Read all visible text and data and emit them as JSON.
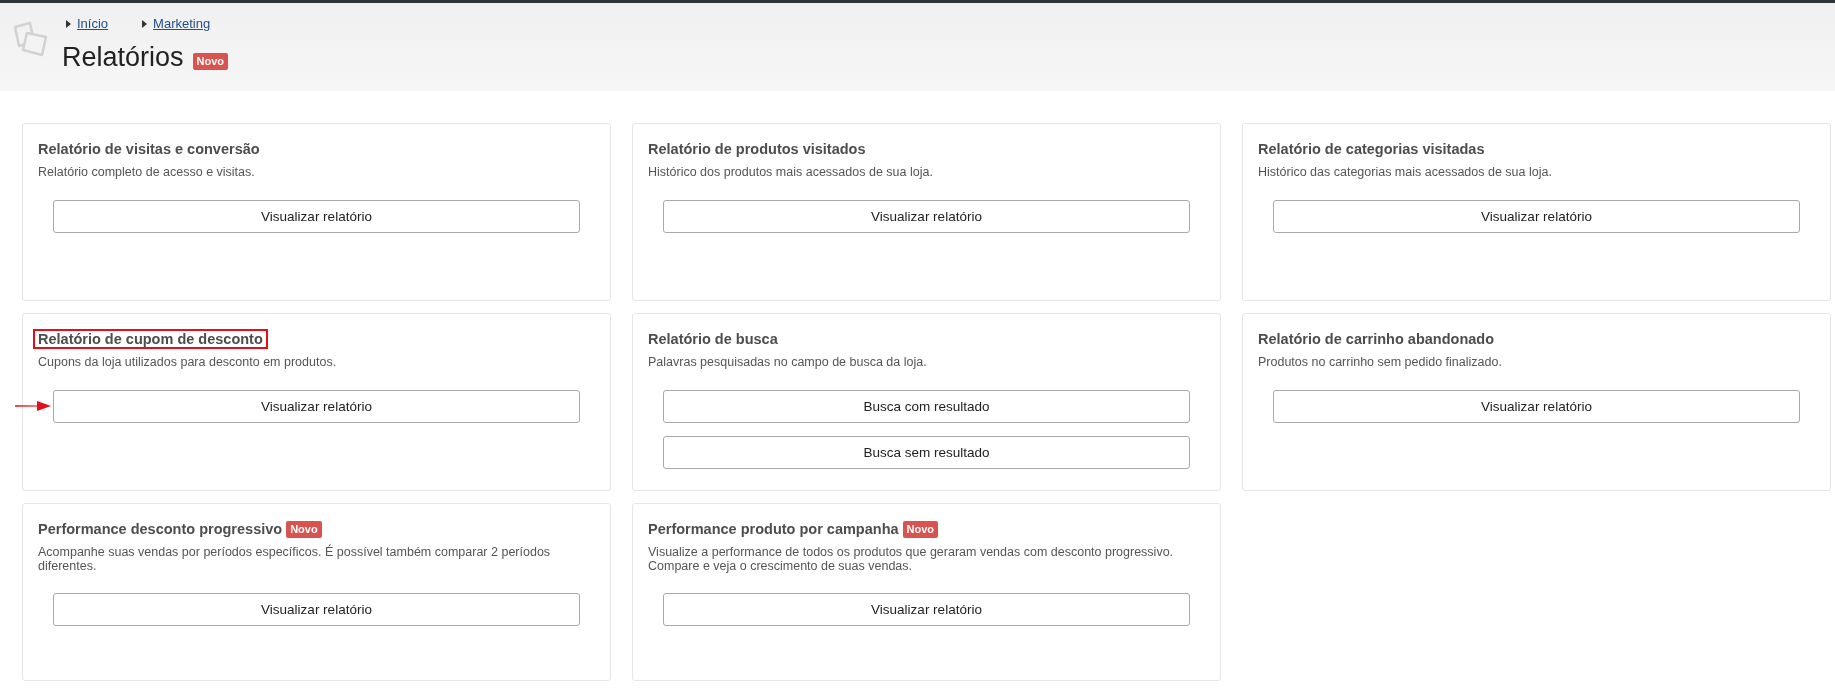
{
  "header": {
    "breadcrumb": [
      {
        "label": "Início"
      },
      {
        "label": "Marketing"
      }
    ],
    "title": "Relatórios",
    "badge": "Novo"
  },
  "cards": [
    {
      "title": "Relatório de visitas e conversão",
      "highlighted": false,
      "description": "Relatório completo de acesso e visitas.",
      "buttons": [
        {
          "label": "Visualizar relatório",
          "arrow": false
        }
      ]
    },
    {
      "title": "Relatório de produtos visitados",
      "highlighted": false,
      "description": "Histórico dos produtos mais acessados de sua loja.",
      "buttons": [
        {
          "label": "Visualizar relatório",
          "arrow": false
        }
      ]
    },
    {
      "title": "Relatório de categorias visitadas",
      "highlighted": false,
      "description": "Histórico das categorias mais acessados de sua loja.",
      "buttons": [
        {
          "label": "Visualizar relatório",
          "arrow": false
        }
      ]
    },
    {
      "title": "Relatório de cupom de desconto",
      "highlighted": true,
      "description": "Cupons da loja utilizados para desconto em produtos.",
      "buttons": [
        {
          "label": "Visualizar relatório",
          "arrow": true
        }
      ]
    },
    {
      "title": "Relatório de busca",
      "highlighted": false,
      "description": "Palavras pesquisadas no campo de busca da loja.",
      "buttons": [
        {
          "label": "Busca com resultado",
          "arrow": false
        },
        {
          "label": "Busca sem resultado",
          "arrow": false
        }
      ]
    },
    {
      "title": "Relatório de carrinho abandonado",
      "highlighted": false,
      "description": "Produtos no carrinho sem pedido finalizado.",
      "buttons": [
        {
          "label": "Visualizar relatório",
          "arrow": false
        }
      ]
    },
    {
      "title": "Performance desconto progressivo",
      "badge": "Novo",
      "highlighted": false,
      "description": "Acompanhe suas vendas por períodos específicos. É possível também comparar 2 períodos diferentes.",
      "buttons": [
        {
          "label": "Visualizar relatório",
          "arrow": false
        }
      ]
    },
    {
      "title": "Performance produto por campanha",
      "badge": "Novo",
      "highlighted": false,
      "description": "Visualize a performance de todos os produtos que geraram vendas com desconto progressivo. Compare e veja o crescimento de suas vendas.",
      "buttons": [
        {
          "label": "Visualizar relatório",
          "arrow": false
        }
      ]
    }
  ]
}
